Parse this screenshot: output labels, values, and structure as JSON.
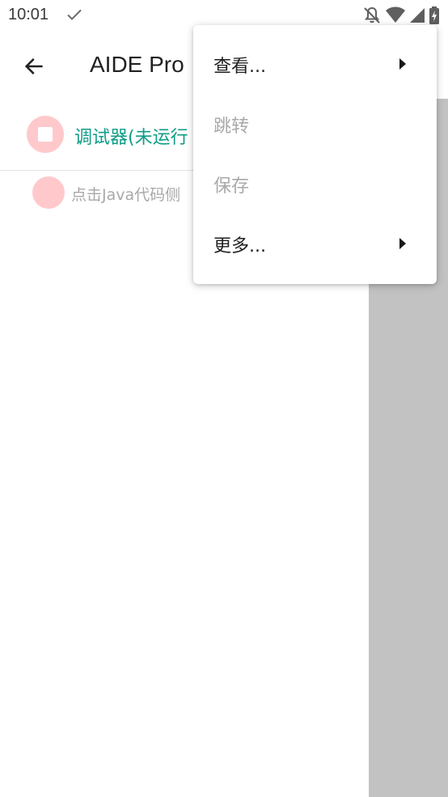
{
  "status_bar": {
    "time": "10:01",
    "icons": [
      "check-icon",
      "notifications-off-icon",
      "wifi-icon",
      "cell-signal-icon",
      "battery-charging-icon"
    ]
  },
  "app_bar": {
    "title": "AIDE Pro",
    "back_icon": "arrow-left-icon"
  },
  "debugger": {
    "label": "调试器(未运行",
    "icon": "stop-icon"
  },
  "hint": {
    "label": "点击Java代码侧"
  },
  "menu": {
    "items": [
      {
        "label": "查看...",
        "enabled": true,
        "submenu": true
      },
      {
        "label": "跳转",
        "enabled": false,
        "submenu": false
      },
      {
        "label": "保存",
        "enabled": false,
        "submenu": false
      },
      {
        "label": "更多...",
        "enabled": true,
        "submenu": true
      }
    ]
  },
  "colors": {
    "accent": "#0f9d87",
    "icon_bg": "#ffc9cc",
    "scrim": "#c2c2c2",
    "disabled_text": "#a9a9a9"
  }
}
